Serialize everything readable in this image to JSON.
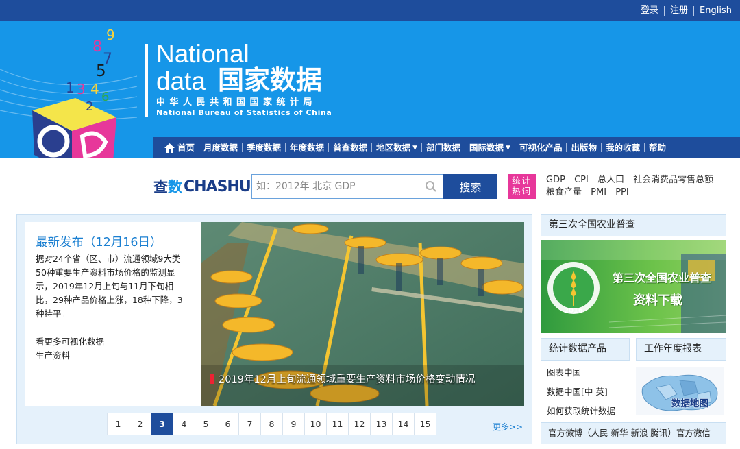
{
  "top_links": {
    "login": "登录",
    "register": "注册",
    "english": "English"
  },
  "brand": {
    "national": "National",
    "data": "data",
    "cn_title": "国家数据",
    "bureau_cn": "中华人民共和国国家统计局",
    "bureau_en": "National Bureau of Statistics of China",
    "cube_digits": [
      "9",
      "8",
      "7",
      "5",
      "1",
      "3",
      "4",
      "6",
      "2"
    ]
  },
  "nav": {
    "home": "首页",
    "monthly": "月度数据",
    "quarterly": "季度数据",
    "annual": "年度数据",
    "census": "普查数据",
    "regional": "地区数据",
    "department": "部门数据",
    "international": "国际数据",
    "visual": "可视化产品",
    "publications": "出版物",
    "favorites": "我的收藏",
    "help": "帮助"
  },
  "search": {
    "logo_cn1": "查",
    "logo_cn2": "数",
    "logo_en": "CHASHU",
    "placeholder": "如：2012年 北京 GDP",
    "button": "搜索",
    "hot_badge": "统计热词",
    "hot_words": [
      "GDP",
      "CPI",
      "总人口",
      "社会消费品零售总额",
      "粮食产量",
      "PMI",
      "PPI"
    ]
  },
  "news": {
    "title": "最新发布（12月16日）",
    "body": "据对24个省（区、市）流通领域9大类50种重要生产资料市场价格的监测显示，2019年12月上旬与11月下旬相比，29种产品价格上涨，18种下降，3种持平。",
    "link1": "看更多可视化数据",
    "link2": "生产资料",
    "photo_caption": "2019年12月上旬流通领域重要生产资料市场价格变动情况"
  },
  "pager": {
    "pages": [
      "1",
      "2",
      "3",
      "4",
      "5",
      "6",
      "7",
      "8",
      "9",
      "10",
      "11",
      "12",
      "13",
      "14",
      "15"
    ],
    "active": "3",
    "more": "更多>>"
  },
  "right": {
    "census_head": "第三次全国农业普查",
    "census_banner_line1": "第三次全国农业普查",
    "census_banner_line2": "资料下载",
    "census_year": "2016",
    "products_head": "统计数据产品",
    "annual_report_head": "工作年度报表",
    "products": [
      "图表中国",
      "数据中国[中 英]",
      "如何获取统计数据"
    ],
    "map_label": "数据地图",
    "footer": "官方微博（人民 新华 新浪 腾讯）官方微信"
  },
  "colors": {
    "topbar": "#1e4d9c",
    "banner": "#1696e8",
    "hot_badge": "#e7379a",
    "panel_bg": "#e5f1fb",
    "link_blue": "#1a7fd1"
  }
}
